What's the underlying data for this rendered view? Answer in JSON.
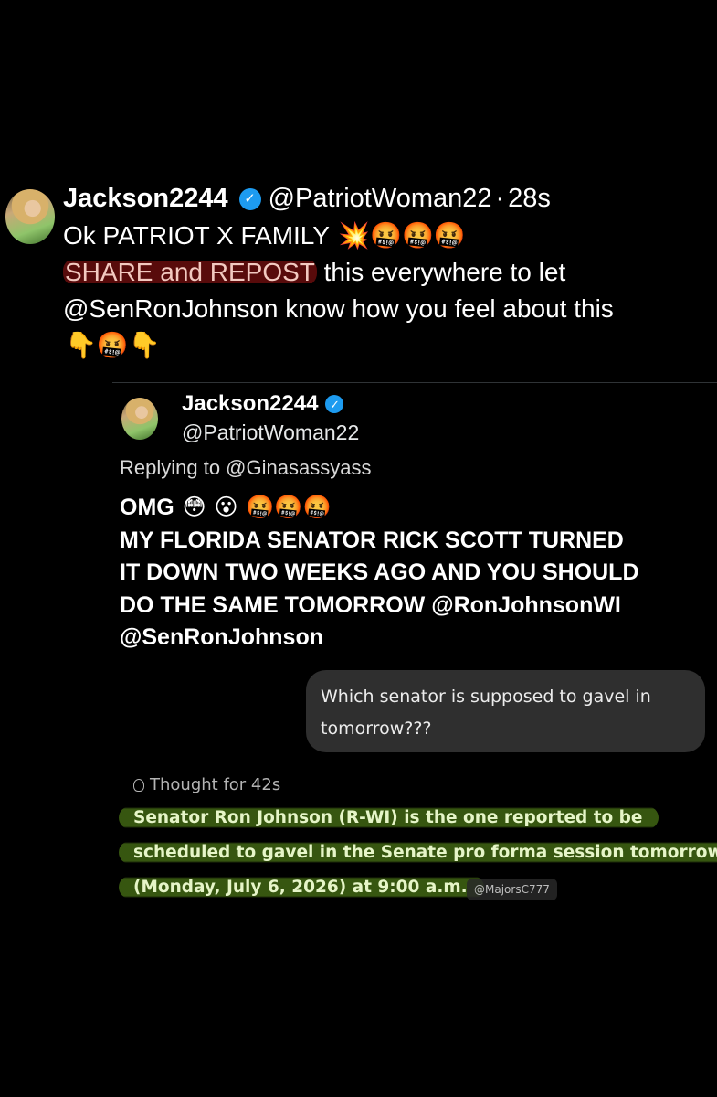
{
  "main_post": {
    "display_name": "Jackson2244",
    "handle": "@PatriotWoman22",
    "separator": "·",
    "time": "28s",
    "line1": "Ok PATRIOT X FAMILY",
    "line1_emoji": "💥🤬🤬🤬",
    "line2_highlight": "SHARE and REPOST",
    "line2_rest": " this everywhere to let",
    "line3": "@SenRonJohnson  know how you feel about this",
    "line4_emoji": "👇🤬👇"
  },
  "quoted_post": {
    "display_name": "Jackson2244",
    "handle": "@PatriotWoman22",
    "replying_to": "Replying to @Ginasassyass",
    "line1": "OMG",
    "line1_emoji": "😳 😮 🤬🤬🤬",
    "line2": "MY FLORIDA SENATOR RICK SCOTT TURNED",
    "line3": "IT DOWN TWO WEEKS AGO AND YOU SHOULD",
    "line4": "DO THE SAME TOMORROW @RonJohnsonWI",
    "line5": "@SenRonJohnson"
  },
  "chat": {
    "user_message": "Which senator is supposed to gavel in tomorrow???",
    "thought_label": "Thought for 42s",
    "answer_line1": "Senator Ron Johnson (R-WI) is the one reported to be",
    "answer_line2": "scheduled to gavel in the Senate pro forma session tomorrow",
    "answer_line3": "(Monday, July 6, 2026) at 9:00 a.m.",
    "credit": "@MajorsC777"
  },
  "icons": {
    "verified": "verified-badge-icon",
    "thought": "lightbulb-icon"
  },
  "colors": {
    "background": "#000000",
    "verified": "#1d9bf0",
    "red_highlight": "#a01414",
    "green_highlight": "#466e14"
  }
}
